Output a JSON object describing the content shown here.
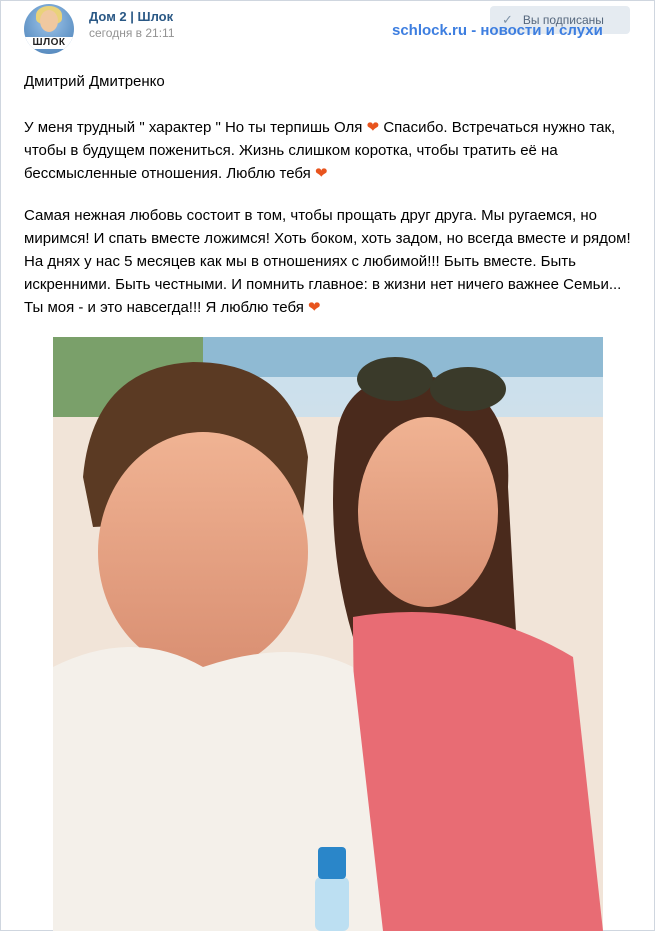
{
  "header": {
    "group_name": "Дом 2 | Шлок",
    "time": "сегодня в 21:11",
    "subscribe_label": "Вы подписаны",
    "watermark": "schlock.ru - новости и слухи",
    "avatar_banner": "ШЛОК"
  },
  "post": {
    "author": "Дмитрий Дмитренко",
    "p1_a": "У меня трудный \" характер \" Но ты терпишь Оля ",
    "p1_b": " Спасибо. Встречаться нужно так, чтобы в будущем пожениться. Жизнь слишком коротка, чтобы тратить её на бессмысленные отношения. Люблю тебя ",
    "p2": "Самая нежная любовь состоит в том, чтобы прощать друг друга. Мы ругаемся, но миримся! И спать вместе ложимся! Хоть боком, хоть задом, но всегда вместе и рядом! На днях у нас 5 месяцев как мы в отношениях с любимой!!! Быть вместе. Быть искренними. Быть честными. И помнить главное: в жизни нет ничего важнее Семьи... Ты моя - и это навсегда!!! Я люблю тебя ",
    "heart": "❤"
  },
  "colors": {
    "link": "#2a5885",
    "watermark": "#3d7ee0",
    "heart": "#e8541e",
    "button_bg": "#e5ebf1"
  },
  "icons": [
    "check-icon",
    "heart-icon"
  ]
}
